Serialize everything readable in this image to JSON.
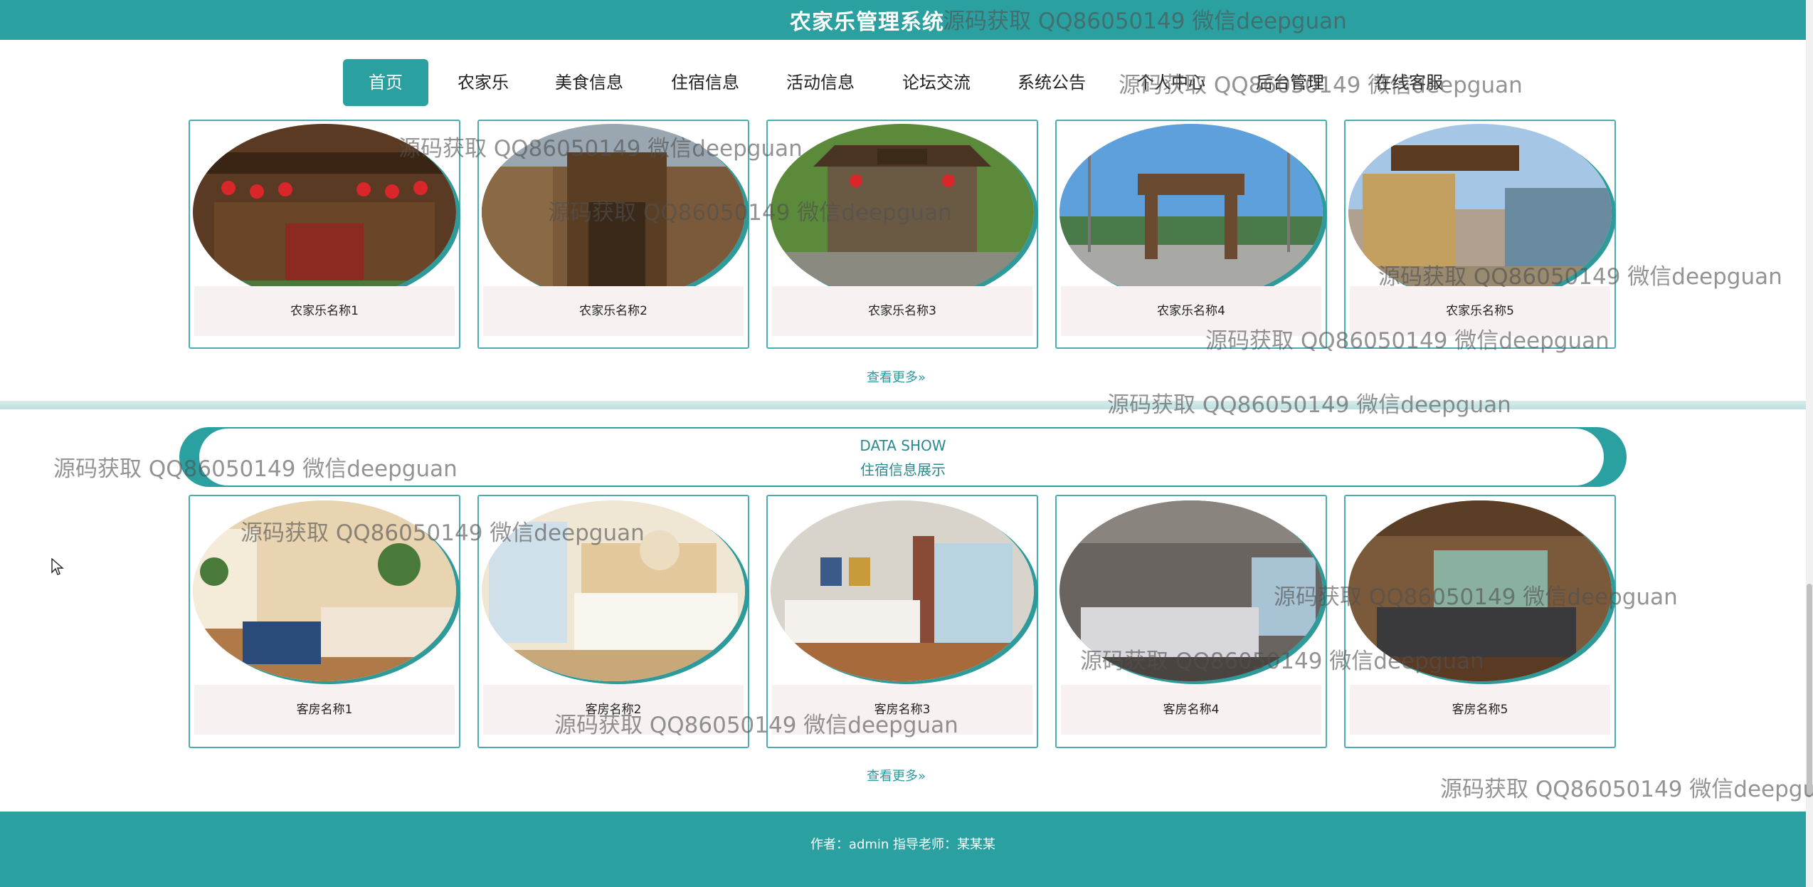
{
  "header": {
    "title": "农家乐管理系统"
  },
  "nav": {
    "items": [
      {
        "label": "首页",
        "active": true
      },
      {
        "label": "农家乐"
      },
      {
        "label": "美食信息"
      },
      {
        "label": "住宿信息"
      },
      {
        "label": "活动信息"
      },
      {
        "label": "论坛交流"
      },
      {
        "label": "系统公告"
      },
      {
        "label": "个人中心"
      },
      {
        "label": "后台管理"
      },
      {
        "label": "在线客服"
      }
    ]
  },
  "farm_section": {
    "cards": [
      {
        "name": "农家乐名称1"
      },
      {
        "name": "农家乐名称2"
      },
      {
        "name": "农家乐名称3"
      },
      {
        "name": "农家乐名称4"
      },
      {
        "name": "农家乐名称5"
      }
    ],
    "more_label": "查看更多»"
  },
  "lodging_section": {
    "banner_en": "DATA SHOW",
    "banner_cn": "住宿信息展示",
    "cards": [
      {
        "name": "客房名称1"
      },
      {
        "name": "客房名称2"
      },
      {
        "name": "客房名称3"
      },
      {
        "name": "客房名称4"
      },
      {
        "name": "客房名称5"
      }
    ],
    "more_label": "查看更多»"
  },
  "footer": {
    "text": "作者：admin 指导老师：某某某"
  },
  "watermark": {
    "text": "源码获取 QQ86050149 微信deepguan"
  },
  "colors": {
    "accent": "#2aa0a0",
    "caption_bg": "#f7f1f1"
  }
}
